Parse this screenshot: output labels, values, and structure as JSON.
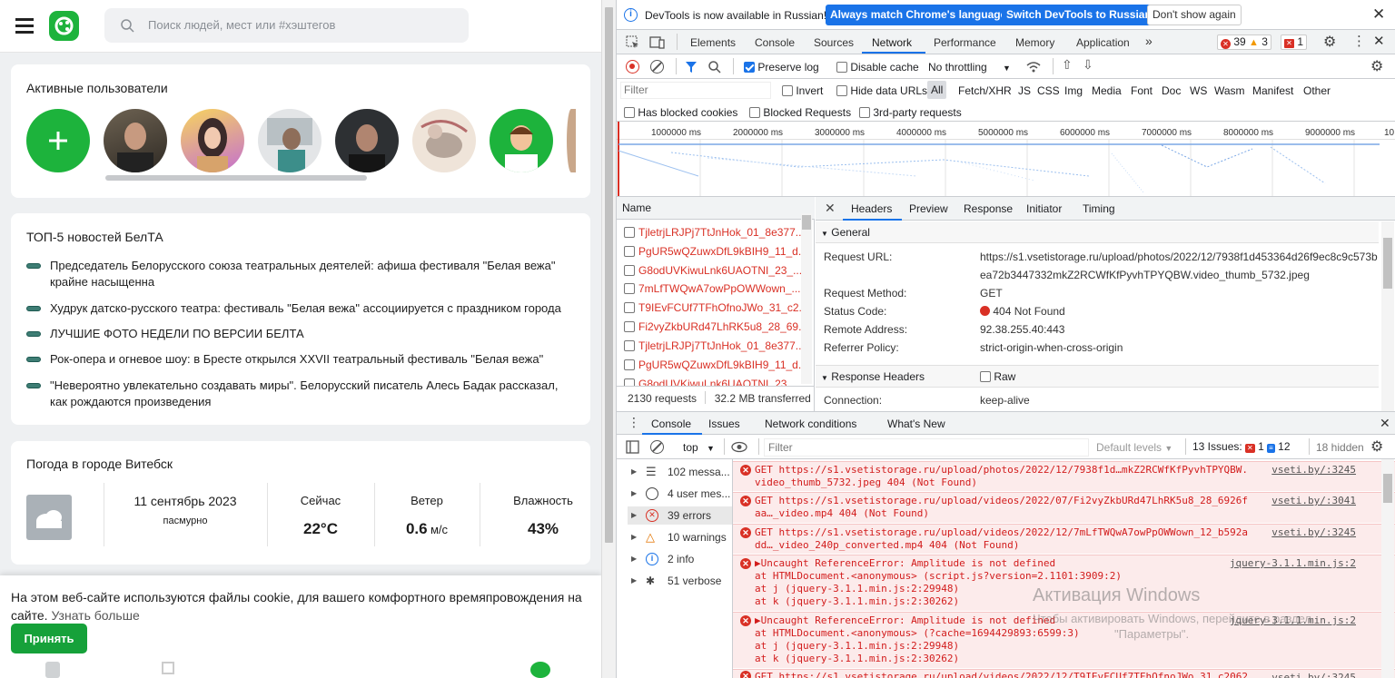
{
  "site": {
    "search_placeholder": "Поиск людей, мест или #хэштегов",
    "active_users_title": "Активные пользователи",
    "news_title": "ТОП-5 новостей БелТА",
    "news": [
      "Председатель Белорусского союза театральных деятелей: афиша фестиваля \"Белая вежа\" крайне насыщенна",
      "Худрук датско-русского театра: фестиваль \"Белая вежа\" ассоциируется с праздником города",
      "ЛУЧШИЕ ФОТО НЕДЕЛИ ПО ВЕРСИИ БЕЛТА",
      "Рок-опера и огневое шоу: в Бресте открылся XXVII театральный фестиваль \"Белая вежа\"",
      "\"Невероятно увлекательно создавать миры\". Белорусский писатель Алесь Бадак рассказал, как рождаются произведения"
    ],
    "weather": {
      "title": "Погода в городе Витебск",
      "date": "11 сентябрь 2023",
      "condition": "пасмурно",
      "now_label": "Сейчас",
      "now_value": "22°C",
      "wind_label": "Ветер",
      "wind_value": "0.6",
      "wind_unit": "м/с",
      "humidity_label": "Влажность",
      "humidity_value": "43%"
    },
    "cookie_text": "На этом веб-сайте используются файлы cookie, для вашего комфортного времяпровождения на сайте.",
    "cookie_link": "Узнать больше",
    "accept_label": "Принять"
  },
  "devtools": {
    "infobar": {
      "message": "DevTools is now available in Russian!",
      "btn_match": "Always match Chrome's language",
      "btn_switch": "Switch DevTools to Russian",
      "btn_dismiss": "Don't show again"
    },
    "tabs": [
      "Elements",
      "Console",
      "Sources",
      "Network",
      "Performance",
      "Memory",
      "Application"
    ],
    "active_tab": "Network",
    "issue_counts": {
      "errors": "39",
      "warnings": "3",
      "issues": "1"
    },
    "toolbar": {
      "preserve_log": "Preserve log",
      "disable_cache": "Disable cache",
      "throttling": "No throttling"
    },
    "filter": {
      "placeholder": "Filter",
      "invert": "Invert",
      "hide_data_urls": "Hide data URLs",
      "types": [
        "All",
        "Fetch/XHR",
        "JS",
        "CSS",
        "Img",
        "Media",
        "Font",
        "Doc",
        "WS",
        "Wasm",
        "Manifest",
        "Other"
      ],
      "blocked_cookies": "Has blocked cookies",
      "blocked_requests": "Blocked Requests",
      "third_party": "3rd-party requests"
    },
    "timeline_ticks": [
      "1000000 ms",
      "2000000 ms",
      "3000000 ms",
      "4000000 ms",
      "5000000 ms",
      "6000000 ms",
      "7000000 ms",
      "8000000 ms",
      "9000000 ms",
      "10"
    ],
    "requests": {
      "header": "Name",
      "items": [
        "TjletrjLRJPj7TtJnHok_01_8e377...",
        "PgUR5wQZuwxDfL9kBIH9_11_d...",
        "G8odUVKiwuLnk6UAOTNI_23_...",
        "7mLfTWQwA7owPpOWWown_...",
        "T9IEvFCUf7TFhOfnoJWo_31_c2...",
        "Fi2vyZkbURd47LhRK5u8_28_69...",
        "TjletrjLRJPj7TtJnHok_01_8e377...",
        "PgUR5wQZuwxDfL9kBIH9_11_d...",
        "G8odUVKiwuLnk6UAOTNI_23_"
      ],
      "count": "2130 requests",
      "transferred": "32.2 MB transferred"
    },
    "detail_tabs": [
      "Headers",
      "Preview",
      "Response",
      "Initiator",
      "Timing"
    ],
    "general": {
      "section": "General",
      "request_url_label": "Request URL:",
      "request_url_1": "https://s1.vsetistorage.ru/upload/photos/2022/12/7938f1d453364d26f9ec8c9c573b",
      "request_url_2": "ea72b3447332mkZ2RCWfKfPyvhTPYQBW.video_thumb_5732.jpeg",
      "method_label": "Request Method:",
      "method": "GET",
      "status_label": "Status Code:",
      "status": "404 Not Found",
      "remote_label": "Remote Address:",
      "remote": "92.38.255.40:443",
      "referrer_label": "Referrer Policy:",
      "referrer": "strict-origin-when-cross-origin"
    },
    "response_headers": {
      "section": "Response Headers",
      "raw": "Raw",
      "connection_label": "Connection:",
      "connection": "keep-alive"
    },
    "drawer_tabs": [
      "Console",
      "Issues",
      "Network conditions",
      "What's New"
    ],
    "console_toolbar": {
      "context": "top",
      "filter_placeholder": "Filter",
      "levels": "Default levels",
      "issues_label": "13 Issues:",
      "issues_err": "1",
      "issues_info": "12",
      "hidden": "18 hidden"
    },
    "sidebar": [
      {
        "label": "102 messa...",
        "icon": "list-icon"
      },
      {
        "label": "4 user mes...",
        "icon": "user-icon"
      },
      {
        "label": "39 errors",
        "icon": "error-icon"
      },
      {
        "label": "10 warnings",
        "icon": "warning-icon"
      },
      {
        "label": "2 info",
        "icon": "info-icon"
      },
      {
        "label": "51 verbose",
        "icon": "bug-icon"
      }
    ],
    "messages": [
      {
        "l1": "GET https://s1.vsetistorage.ru/upload/photos/2022/12/7938f1d…mkZ2RCWfKfPyvhTPYQBW.",
        "l2": "video_thumb_5732.jpeg 404 (Not Found)",
        "src": "vseti.by/:3245"
      },
      {
        "l1": "GET https://s1.vsetistorage.ru/upload/videos/2022/07/Fi2vyZkbURd47LhRK5u8_28_6926f",
        "l2": "aa…_video.mp4 404 (Not Found)",
        "src": "vseti.by/:3041"
      },
      {
        "l1": "GET https://s1.vsetistorage.ru/upload/videos/2022/12/7mLfTWQwA7owPpOWWown_12_b592a",
        "l2": "dd…_video_240p_converted.mp4 404 (Not Found)",
        "src": "vseti.by/:3245"
      },
      {
        "l1": "▶Uncaught ReferenceError: Amplitude is not defined",
        "l2": "    at HTMLDocument.<anonymous> (script.js?version=2.1101:3909:2)",
        "l3": "    at j (jquery-3.1.1.min.js:2:29948)",
        "l4": "    at k (jquery-3.1.1.min.js:2:30262)",
        "src": "jquery-3.1.1.min.js:2"
      },
      {
        "l1": "▶Uncaught ReferenceError: Amplitude is not defined",
        "l2": "    at HTMLDocument.<anonymous> (?cache=1694429893:6599:3)",
        "l3": "    at j (jquery-3.1.1.min.js:2:29948)",
        "l4": "    at k (jquery-3.1.1.min.js:2:30262)",
        "src": "jquery-3.1.1.min.js:2"
      },
      {
        "l1": "GET https://s1.vsetistorage.ru/upload/videos/2022/12/T9IEvFCUf7TFhOfnoJWo_31_c2062",
        "src": "vseti.by/:3245"
      }
    ],
    "watermark": {
      "title": "Активация Windows",
      "subtitle": "Чтобы активировать Windows, перейдите в раздел",
      "subtitle2": "\"Параметры\"."
    }
  }
}
